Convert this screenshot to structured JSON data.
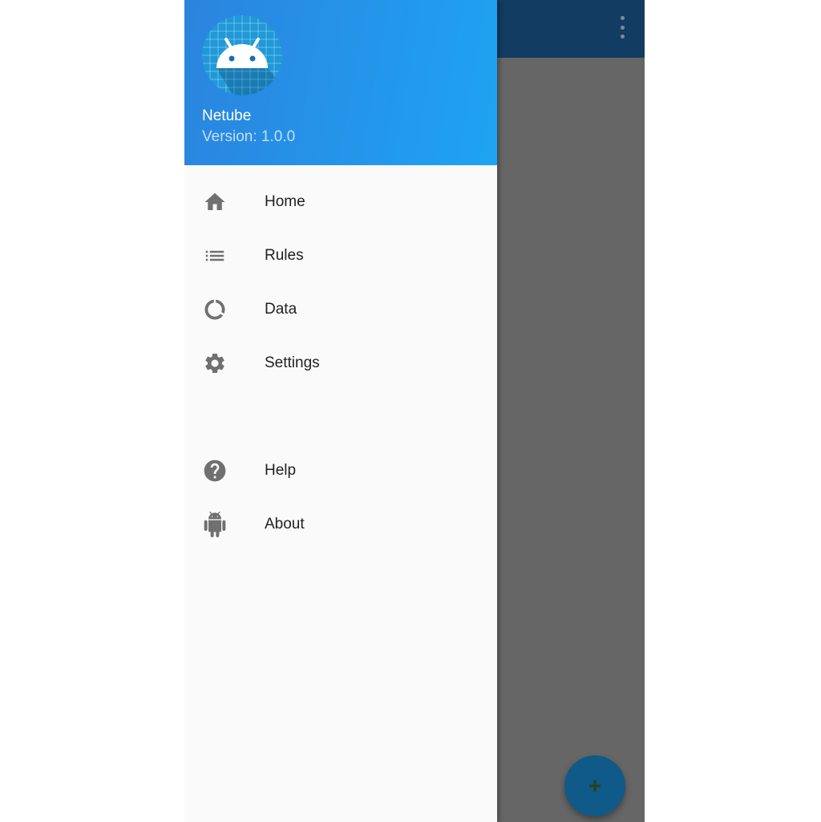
{
  "app_bar": {
    "overflow_icon": "more-vert-icon"
  },
  "header": {
    "app_name": "Netube",
    "version": "Version: 1.0.0",
    "logo_icon": "android-logo-icon"
  },
  "menu": {
    "primary": [
      {
        "label": "Home",
        "icon": "home-icon"
      },
      {
        "label": "Rules",
        "icon": "list-icon"
      },
      {
        "label": "Data",
        "icon": "data-usage-icon"
      },
      {
        "label": "Settings",
        "icon": "gear-icon"
      }
    ],
    "secondary": [
      {
        "label": "Help",
        "icon": "help-icon"
      },
      {
        "label": "About",
        "icon": "android-icon"
      }
    ]
  },
  "fab": {
    "icon": "plus-icon",
    "label": "+"
  },
  "colors": {
    "header_start": "#2b84de",
    "header_end": "#1ea3f3",
    "app_bar": "#123c61",
    "scrim": "#666666",
    "icon_gray": "#707070",
    "fab": "#0f5a88"
  }
}
